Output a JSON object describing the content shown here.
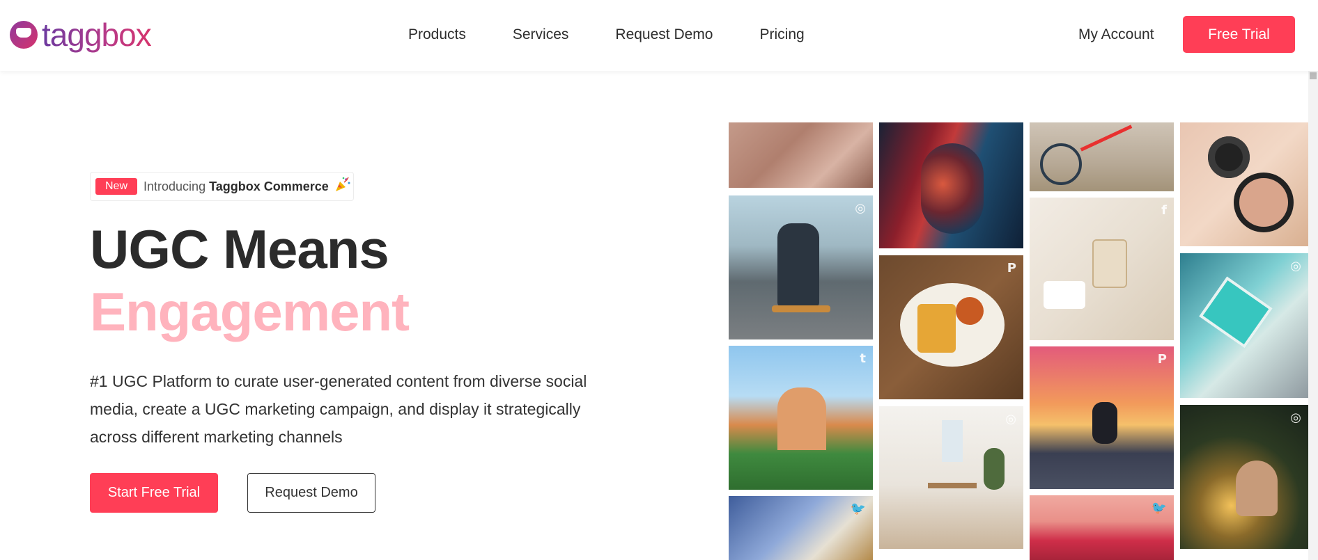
{
  "header": {
    "logo_text": "taggbox",
    "nav": [
      "Products",
      "Services",
      "Request Demo",
      "Pricing"
    ],
    "my_account": "My Account",
    "free_trial": "Free Trial"
  },
  "hero": {
    "badge_new": "New",
    "badge_intro": "Introducing",
    "badge_product": "Taggbox Commerce",
    "heading_line1": "UGC Means",
    "heading_line2": "Engagement",
    "description": "#1 UGC Platform to curate user-generated content from diverse social media, create a UGC marketing campaign, and display it strategically across different marketing channels",
    "cta_primary": "Start Free Trial",
    "cta_secondary": "Request Demo"
  },
  "colors": {
    "accent": "#ff3e56",
    "heading_dark": "#2b2b2b",
    "heading_pink": "#ffb3bd"
  },
  "gallery": {
    "tiles": [
      {
        "name": "knit-sweater-photo",
        "network_icon": ""
      },
      {
        "name": "skater-street-photo",
        "network_icon": "instagram-icon"
      },
      {
        "name": "resort-palm-photo",
        "network_icon": "tumblr-icon"
      },
      {
        "name": "tea-cups-photo",
        "network_icon": "twitter-icon"
      },
      {
        "name": "portrait-neon-photo",
        "network_icon": ""
      },
      {
        "name": "fries-plate-photo",
        "network_icon": "pinterest-icon"
      },
      {
        "name": "dining-room-photo",
        "network_icon": "instagram-icon"
      },
      {
        "name": "bicycle-photo",
        "network_icon": ""
      },
      {
        "name": "pearls-perfume-photo",
        "network_icon": "facebook-icon"
      },
      {
        "name": "skatepark-sunset-photo",
        "network_icon": "pinterest-icon"
      },
      {
        "name": "tulip-field-photo",
        "network_icon": "twitter-icon"
      },
      {
        "name": "makeup-compact-photo",
        "network_icon": ""
      },
      {
        "name": "ocean-pool-photo",
        "network_icon": "instagram-icon"
      },
      {
        "name": "child-lights-photo",
        "network_icon": "instagram-icon"
      }
    ]
  }
}
